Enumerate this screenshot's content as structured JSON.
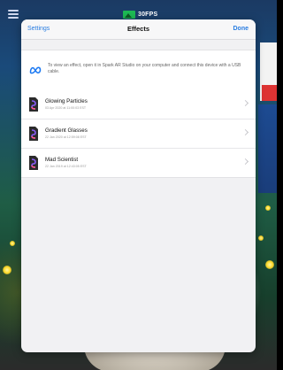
{
  "overlay": {
    "fps_label": "30FPS"
  },
  "modal": {
    "nav": {
      "left_label": "Settings",
      "title": "Effects",
      "right_label": "Done"
    },
    "notice": {
      "icon": "meta-logo-icon",
      "text": "To view an effect, open it in Spark AR Studio on your computer and connect this device with a USB cable."
    },
    "effects": [
      {
        "name": "Glowing Particles",
        "date": "03 Apr 2020 at 11:00:03 EST",
        "icon": "spark-file-icon"
      },
      {
        "name": "Gradient Glasses",
        "date": "22 Jan 2020 at 12:59:08 EST",
        "icon": "spark-file-icon"
      },
      {
        "name": "Mad Scientist",
        "date": "22 Jan 2019 at 12:43:05 EST",
        "icon": "spark-file-icon"
      }
    ]
  },
  "colors": {
    "accent": "#2a7de1",
    "fps_badge": "#1db954"
  }
}
